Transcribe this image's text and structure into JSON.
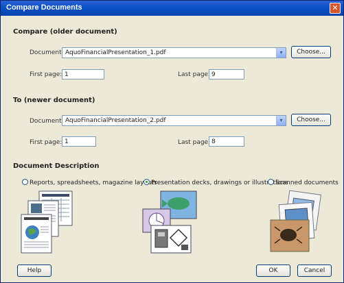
{
  "dialog": {
    "title": "Compare Documents",
    "close_glyph": "✕"
  },
  "older": {
    "heading": "Compare (older document)",
    "document_label": "Document:",
    "document_value": "AquoFinancialPresentation_1.pdf",
    "choose_label": "Choose...",
    "first_page_label": "First page:",
    "first_page_value": "1",
    "last_page_label": "Last page:",
    "last_page_value": "9"
  },
  "newer": {
    "heading": "To (newer document)",
    "document_label": "Document:",
    "document_value": "AquoFinancialPresentation_2.pdf",
    "choose_label": "Choose...",
    "first_page_label": "First page:",
    "first_page_value": "1",
    "last_page_label": "Last page:",
    "last_page_value": "8"
  },
  "description": {
    "heading": "Document Description",
    "options": [
      {
        "label": "Reports, spreadsheets, magazine layouts",
        "selected": false
      },
      {
        "label": "Presentation decks, drawings or illustrations",
        "selected": true
      },
      {
        "label": "Scanned documents",
        "selected": false
      }
    ]
  },
  "footer": {
    "help_label": "Help",
    "ok_label": "OK",
    "cancel_label": "Cancel"
  },
  "icons": {
    "dropdown": "▾"
  }
}
